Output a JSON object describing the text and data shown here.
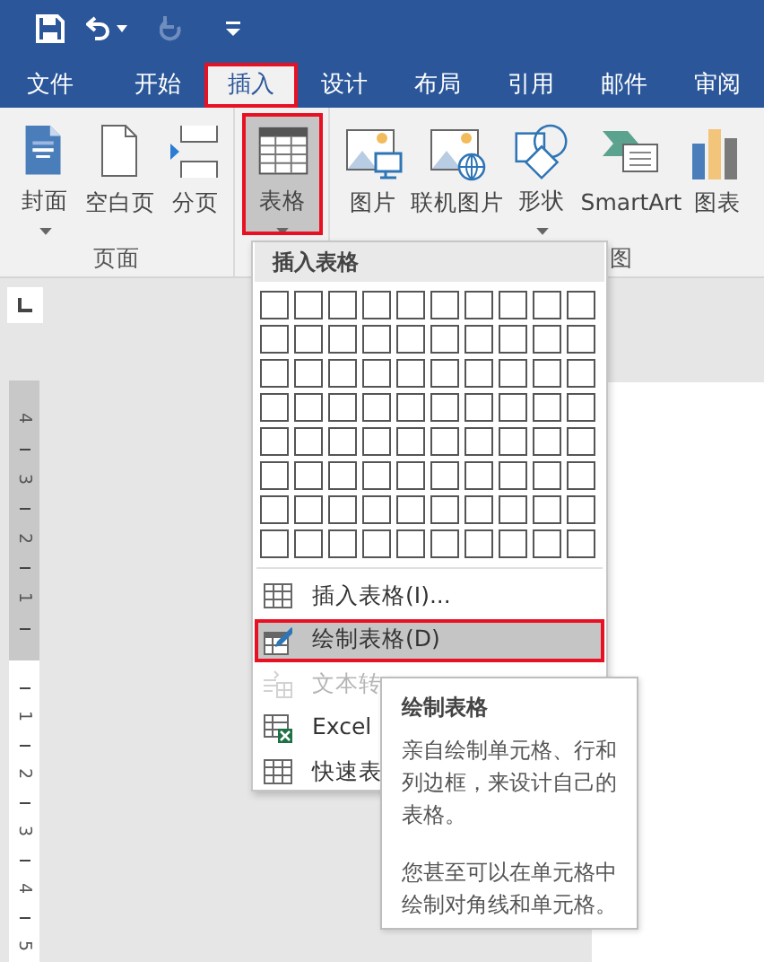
{
  "quick_access": {
    "redo": {
      "disabled": true
    }
  },
  "tabs": [
    {
      "label": "文件",
      "selected": false,
      "outlined": false
    },
    {
      "label": "开始",
      "selected": false,
      "outlined": false
    },
    {
      "label": "插入",
      "selected": true,
      "outlined": true
    },
    {
      "label": "设计",
      "selected": false,
      "outlined": false
    },
    {
      "label": "布局",
      "selected": false,
      "outlined": false
    },
    {
      "label": "引用",
      "selected": false,
      "outlined": false
    },
    {
      "label": "邮件",
      "selected": false,
      "outlined": false
    },
    {
      "label": "审阅",
      "selected": false,
      "outlined": false
    }
  ],
  "ribbon": {
    "groups": [
      {
        "label": "页面",
        "buttons": [
          {
            "label": "封面",
            "has_menu": true,
            "selected": false,
            "outlined": false
          },
          {
            "label": "空白页",
            "has_menu": false,
            "selected": false,
            "outlined": false
          },
          {
            "label": "分页",
            "has_menu": false,
            "selected": false,
            "outlined": false
          }
        ]
      },
      {
        "buttons": [
          {
            "label": "表格",
            "has_menu": true,
            "selected": true,
            "outlined": true
          }
        ]
      },
      {
        "label": "图",
        "buttons": [
          {
            "label": "图片",
            "has_menu": false,
            "selected": false,
            "outlined": false
          },
          {
            "label": "联机图片",
            "has_menu": false,
            "selected": false,
            "outlined": false
          },
          {
            "label": "形状",
            "has_menu": true,
            "selected": false,
            "outlined": false
          },
          {
            "label": "SmartArt",
            "has_menu": false,
            "selected": false,
            "outlined": false
          },
          {
            "label": "图表",
            "has_menu": false,
            "selected": false,
            "outlined": false
          }
        ]
      }
    ]
  },
  "ruler": {
    "upper": [
      "4",
      "3",
      "2",
      "1"
    ],
    "lower": [
      "1",
      "2",
      "3",
      "4",
      "5"
    ]
  },
  "table_menu": {
    "title": "插入表格",
    "items": [
      {
        "label": "插入表格(I)...",
        "disabled": false,
        "selected": false,
        "outlined": false
      },
      {
        "label": "绘制表格(D)",
        "disabled": false,
        "selected": true,
        "outlined": true
      },
      {
        "label": "文本转",
        "disabled": true,
        "selected": false,
        "outlined": false
      },
      {
        "label": "Excel",
        "disabled": false,
        "selected": false,
        "outlined": false
      },
      {
        "label": "快速表",
        "disabled": false,
        "selected": false,
        "outlined": false
      }
    ]
  },
  "tooltip": {
    "title": "绘制表格",
    "paragraphs": [
      "亲自绘制单元格、行和列边框，来设计自己的表格。",
      "您甚至可以在单元格中绘制对角线和单元格。"
    ]
  }
}
